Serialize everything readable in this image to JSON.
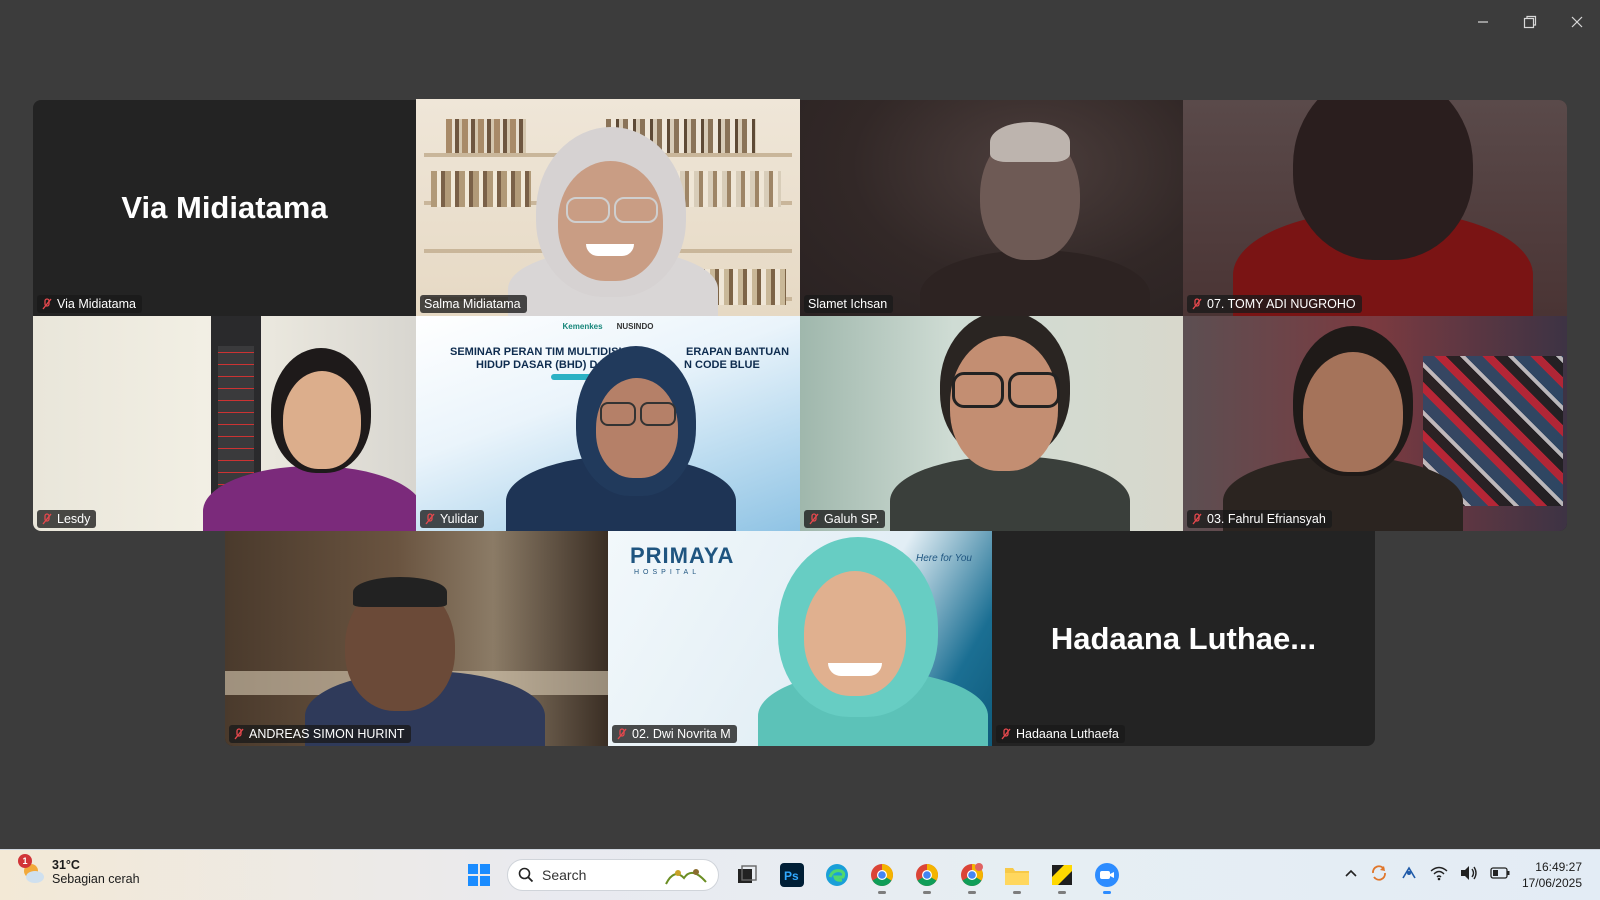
{
  "window": {
    "minimize_label": "Minimize",
    "restore_label": "Restore",
    "close_label": "Close"
  },
  "participants": [
    {
      "name": "Via Midiatama",
      "display": "Via Midiatama",
      "muted": true,
      "video": false
    },
    {
      "name": "Salma Midiatama",
      "muted": false,
      "video": true,
      "active_speaker": true
    },
    {
      "name": "Slamet  Ichsan",
      "muted": false,
      "video": true
    },
    {
      "name": "07. TOMY ADI NUGROHO",
      "muted": true,
      "video": true
    },
    {
      "name": "Lesdy",
      "muted": true,
      "video": true
    },
    {
      "name": "Yulidar",
      "muted": true,
      "video": true
    },
    {
      "name": "Galuh SP.",
      "muted": true,
      "video": true
    },
    {
      "name": "03. Fahrul Efriansyah",
      "muted": true,
      "video": true
    },
    {
      "name": "ANDREAS SIMON HURINT",
      "muted": true,
      "video": true
    },
    {
      "name": "02. Dwi Novrita M",
      "muted": true,
      "video": true
    },
    {
      "name": "Hadaana Luthaefa",
      "display": "Hadaana  Luthae...",
      "muted": true,
      "video": false
    }
  ],
  "virtual_backgrounds": {
    "yulidar": {
      "logos": [
        "Kemenkes",
        "NUSINDO"
      ],
      "headline_1": "SEMINAR PERAN TIM MULTIDISI",
      "headline_1b": "ERAPAN BANTUAN",
      "headline_2": "HIDUP DASAR (BHD) DA",
      "headline_2b": "N CODE BLUE"
    },
    "dwi": {
      "brand": "PRIMAYA",
      "brand_sub": "HOSPITAL",
      "tagline": "Here for You"
    }
  },
  "taskbar": {
    "weather": {
      "notification_count": "1",
      "temp": "31°C",
      "desc": "Sebagian cerah"
    },
    "search_placeholder": "Search",
    "clock": {
      "time": "16:49:27",
      "date": "17/06/2025"
    }
  },
  "colors": {
    "active_speaker": "#2ee58a",
    "background": "#3c3c3c",
    "muted_icon": "#e5484d"
  }
}
